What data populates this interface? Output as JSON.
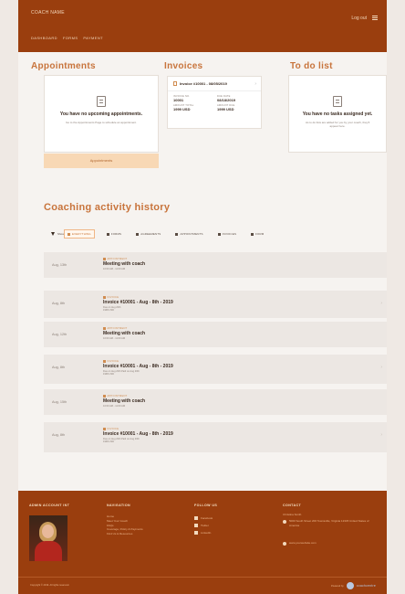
{
  "header": {
    "brand": "COACH NAME",
    "nav": [
      "DASHBOARD",
      "FORMS",
      "PAYMENT"
    ],
    "login_label": "Log out"
  },
  "appointments": {
    "title": "Appointments",
    "empty_heading": "You have no upcoming appointments.",
    "empty_sub": "Go to the Appointments Page to schedule an appointment.",
    "button_label": "Appointments"
  },
  "invoices": {
    "title": "Invoices",
    "card": {
      "heading": "Invoice #10001 - 08/05/2019",
      "invoice_no_label": "INVOICE NO.",
      "invoice_no": "10001",
      "due_date_label": "DUE DATE",
      "due_date": "08/18/2019",
      "amount_total_label": "AMOUNT TOTAL",
      "amount_total": "1999 USD",
      "amount_due_label": "AMOUNT DUE",
      "amount_due": "1999 USD"
    }
  },
  "todo": {
    "title": "To do list",
    "empty_heading": "You have no tasks assigned yet.",
    "empty_sub": "As to do lists are added for you by your coach, they'll appear here."
  },
  "activity": {
    "title": "Coaching activity history",
    "filter_label": "Show",
    "filters": [
      "EVERYTHING",
      "FORMS",
      "AGREEMENTS",
      "APPOINTMENTS",
      "INVOICES",
      "FORM"
    ],
    "rows": [
      {
        "date": "Aug, 13th",
        "category": "APPOINTMENT",
        "title": "Meeting with coach",
        "sub": "10:00 AM - 11:00 AM"
      },
      {
        "date": "Aug, 8th",
        "category": "INVOICE",
        "title": "Invoice #10001 - Aug - 8th - 2019",
        "sub": "Due on Aug 20th",
        "sub2": "1999 USD"
      },
      {
        "date": "Aug, 12th",
        "category": "APPOINTMENT",
        "title": "Meeting with coach",
        "sub": "10:00 AM - 11:00 AM"
      },
      {
        "date": "Aug, 8th",
        "category": "INVOICE",
        "title": "Invoice #10001 - Aug - 8th - 2019",
        "sub": "Due on Aug 20th Paid on Aug 20th",
        "sub2": "1999 USD"
      },
      {
        "date": "Aug, 15th",
        "category": "APPOINTMENT",
        "title": "Meeting with coach",
        "sub": "10:00 AM - 11:00 AM"
      },
      {
        "date": "Aug, 8th",
        "category": "INVOICE",
        "title": "Invoice #10001 - Aug - 8th - 2019",
        "sub": "Due on Aug 20th Paid on Aug 20th",
        "sub2": "1999 USD"
      }
    ]
  },
  "footer": {
    "account_heading": "ADMIN ACCOUNT INT",
    "nav_heading": "NAVIGATION",
    "nav_links": [
      "Home",
      "Meet Your Coach",
      "FAQs",
      "Coverage, Policy & Payments",
      "Find Us & Resources"
    ],
    "follow_heading": "FOLLOW US",
    "follow_links": [
      "Facebook",
      "Twitter",
      "LinkedIn"
    ],
    "contact_heading": "CONTACT",
    "contact_name": "Christina Smith",
    "contact_address": "5000 South Street 200 Townsville, Virginia 12345 United States of America",
    "contact_web": "www.yourwebsite.com",
    "copyright": "Copyright © 2019. All rights reserved.",
    "powered_label": "Powered by",
    "powered_brand": "coachcentre"
  }
}
